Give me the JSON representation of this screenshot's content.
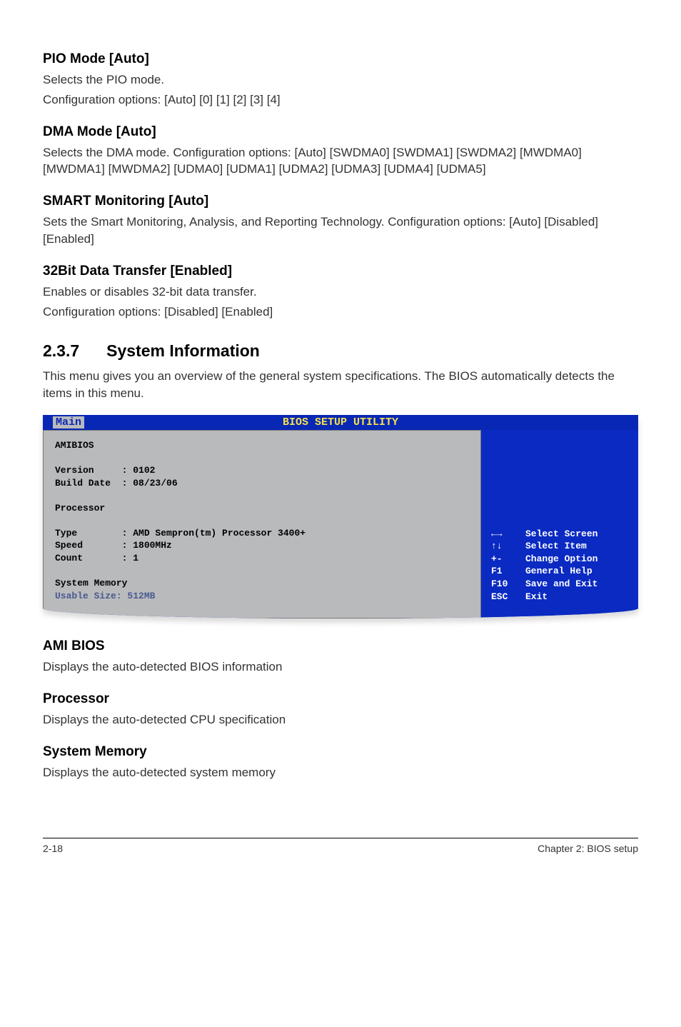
{
  "sections": {
    "pio_mode": {
      "heading": "PIO Mode [Auto]",
      "line1": "Selects the PIO mode.",
      "line2": "Configuration options: [Auto] [0] [1] [2] [3] [4]"
    },
    "dma_mode": {
      "heading": "DMA Mode [Auto]",
      "body": "Selects the DMA mode. Configuration options: [Auto] [SWDMA0] [SWDMA1] [SWDMA2] [MWDMA0] [MWDMA1] [MWDMA2] [UDMA0] [UDMA1] [UDMA2] [UDMA3] [UDMA4] [UDMA5]"
    },
    "smart": {
      "heading": "SMART Monitoring [Auto]",
      "body": "Sets the Smart Monitoring, Analysis, and Reporting Technology. Configuration options: [Auto] [Disabled] [Enabled]"
    },
    "bit32": {
      "heading": "32Bit Data Transfer [Enabled]",
      "line1": "Enables or disables 32-bit data transfer.",
      "line2": "Configuration options: [Disabled] [Enabled]"
    },
    "sysinfo": {
      "number": "2.3.7",
      "title": "System Information",
      "body": "This menu gives you an overview of the general system specifications. The BIOS automatically detects the items in this menu."
    },
    "ami_bios": {
      "heading": "AMI BIOS",
      "body": "Displays the auto-detected BIOS information"
    },
    "processor": {
      "heading": "Processor",
      "body": "Displays the auto-detected CPU specification"
    },
    "sysmem": {
      "heading": "System Memory",
      "body": "Displays the auto-detected system memory"
    }
  },
  "bios": {
    "title": "BIOS SETUP UTILITY",
    "tab": "Main",
    "left": {
      "amibios_label": "AMIBIOS",
      "version": "Version     : 0102",
      "build_date": "Build Date  : 08/23/06",
      "processor_label": "Processor",
      "cpu_type": "Type        : AMD Sempron(tm) Processor 3400+",
      "cpu_speed": "Speed       : 1800MHz",
      "cpu_count": "Count       : 1",
      "sysmem_label": "System Memory",
      "usable": "Usable Size: 512MB"
    },
    "help": [
      {
        "key": "←→",
        "desc": "Select Screen"
      },
      {
        "key": "↑↓",
        "desc": "Select Item"
      },
      {
        "key": "+-",
        "desc": "Change Option"
      },
      {
        "key": "F1",
        "desc": "General Help"
      },
      {
        "key": "F10",
        "desc": "Save and Exit"
      },
      {
        "key": "ESC",
        "desc": "Exit"
      }
    ]
  },
  "footer": {
    "page": "2-18",
    "chapter": "Chapter 2: BIOS setup"
  }
}
